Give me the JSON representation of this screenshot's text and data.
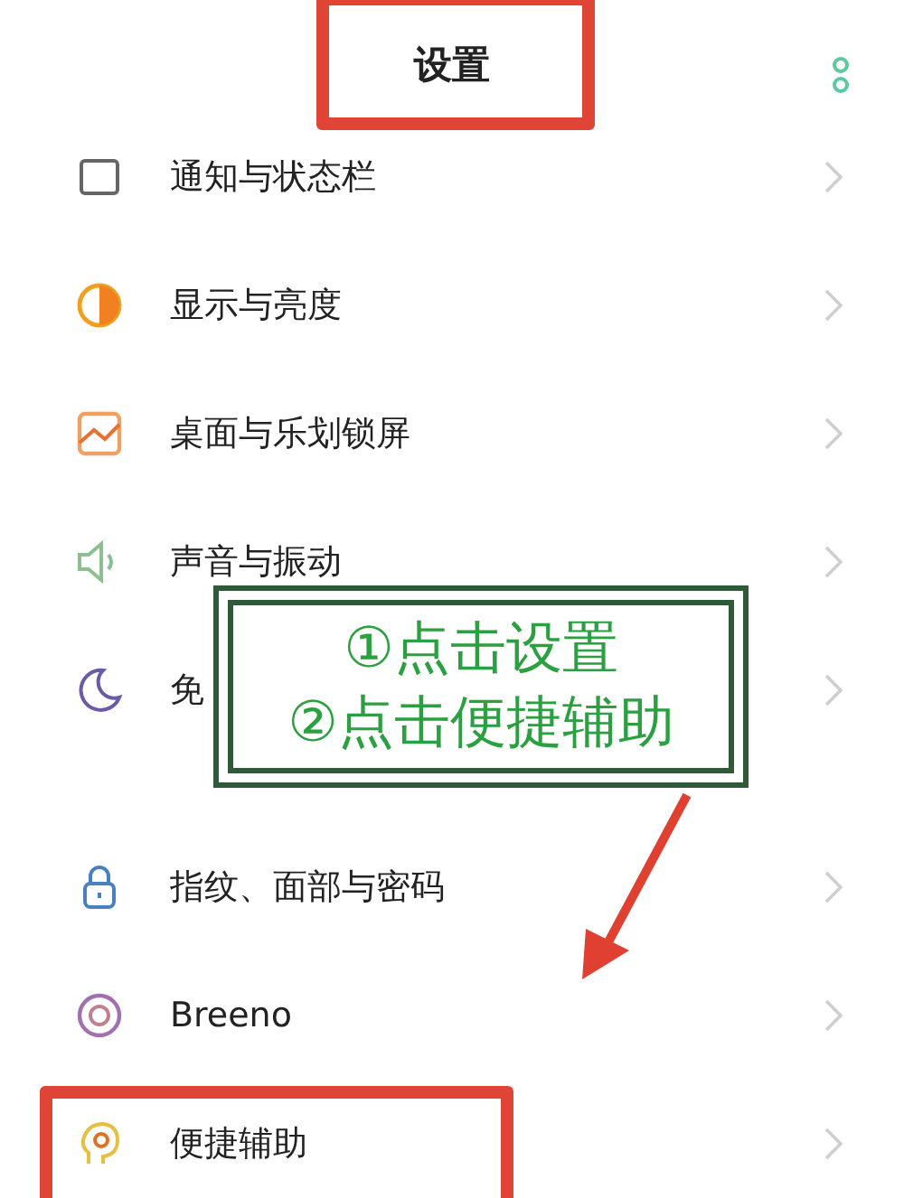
{
  "header": {
    "title": "设置",
    "marked": true
  },
  "sections": [
    {
      "items": [
        {
          "label": "通知与状态栏",
          "marked": false
        },
        {
          "label": "显示与亮度",
          "marked": false
        },
        {
          "label": "桌面与乐划锁屏",
          "marked": false
        },
        {
          "label": "声音与振动",
          "marked": false
        },
        {
          "label": "免",
          "marked": false
        }
      ]
    },
    {
      "items": [
        {
          "label": "指纹、面部与密码",
          "marked": false
        },
        {
          "label": "Breeno",
          "marked": false
        },
        {
          "label": "便捷辅助",
          "marked": true
        }
      ]
    }
  ],
  "annotation": {
    "lines": [
      "①点击设置",
      "②点击便捷辅助"
    ]
  }
}
